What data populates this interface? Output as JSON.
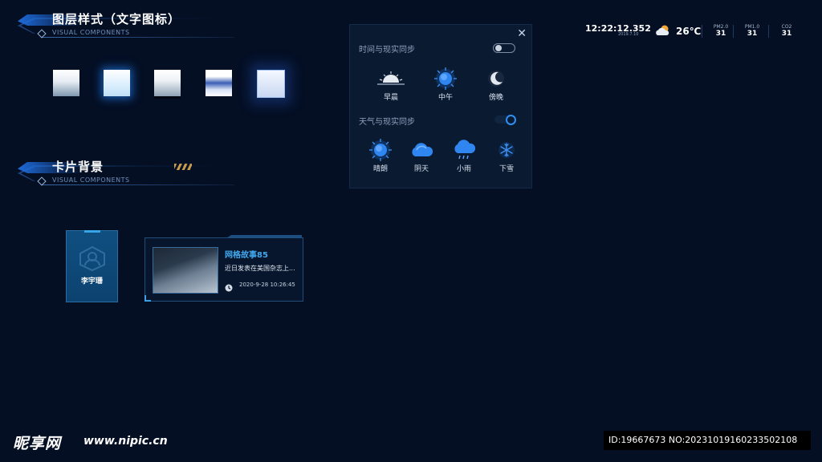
{
  "sections": {
    "layer": {
      "title": "图层样式（文字图标）",
      "subtitle": "VISUAL COMPONENTS"
    },
    "card": {
      "title": "卡片背景",
      "subtitle": "VISUAL COMPONENTS"
    }
  },
  "panel": {
    "time_sync_label": "时间与现实同步",
    "time_sync_on": false,
    "weather_sync_label": "天气与现实同步",
    "weather_sync_on": true,
    "times": [
      {
        "icon": "sunrise-icon",
        "label": "早晨"
      },
      {
        "icon": "sun-icon",
        "label": "中午"
      },
      {
        "icon": "moon-icon",
        "label": "傍晚"
      }
    ],
    "weathers": [
      {
        "icon": "sun-icon",
        "label": "晴朗"
      },
      {
        "icon": "cloud-icon",
        "label": "阴天"
      },
      {
        "icon": "rain-cloud-icon",
        "label": "小雨"
      },
      {
        "icon": "snowflake-icon",
        "label": "下雪"
      }
    ]
  },
  "status": {
    "time": "12:22:12.352",
    "date": "2019.7.10",
    "temperature": "26℃",
    "weather_icon": "partly-cloudy-icon",
    "metrics": [
      {
        "label": "PM2.0",
        "value": "31"
      },
      {
        "label": "PM1.0",
        "value": "31"
      },
      {
        "label": "CO2",
        "value": "31"
      }
    ]
  },
  "person_card": {
    "name": "李宇珊",
    "icon": "user-avatar-icon"
  },
  "info_card": {
    "title": "网格故事85",
    "description": "近日发表在美国杂志上...",
    "datetime": "2020-9-28 10:26:45",
    "icon": "clock-icon"
  },
  "watermark": {
    "logo": "昵享网",
    "url": "www.nipic.cn",
    "id_text": "ID:19667673 NO:20231019160233502108"
  },
  "colors": {
    "background": "#040f24",
    "accent": "#41a7ef",
    "panel": "#0a1a31",
    "card": "#0f4f80"
  }
}
